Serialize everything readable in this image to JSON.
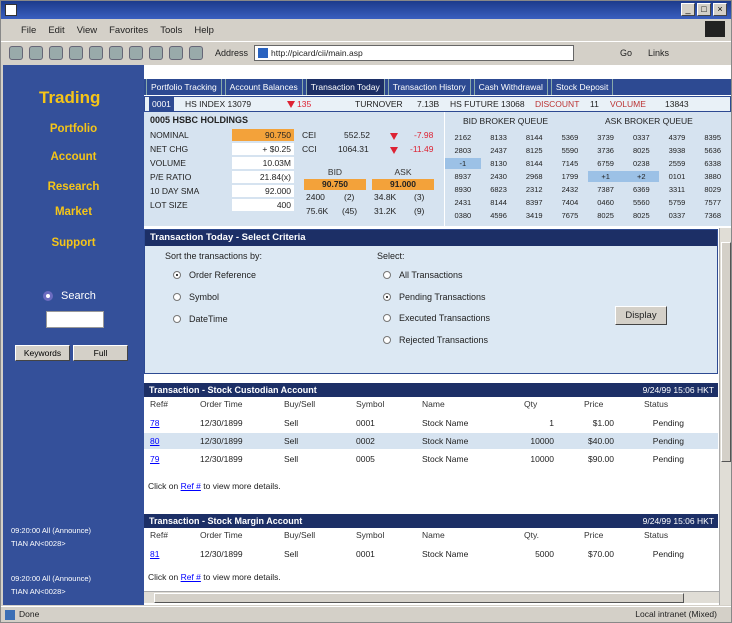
{
  "menu": [
    "File",
    "Edit",
    "View",
    "Favorites",
    "Tools",
    "Help"
  ],
  "toolbar": {
    "address_label": "Address",
    "url": "http://picard/cii/main.asp",
    "go": "Go",
    "links": "Links"
  },
  "sidebar": {
    "brand": "Trading",
    "items": [
      "Portfolio",
      "Account",
      "Research",
      "Market",
      "Support"
    ],
    "search_label": "Search",
    "keywords_btn": "Keywords",
    "full_btn": "Full",
    "announcements": [
      "09:20:00 All (Announce)",
      "TIAN AN<0028>",
      "09:20:00 All (Announce)",
      "TIAN AN<0028>"
    ]
  },
  "tabs": [
    "Portfolio Tracking",
    "Account Balances",
    "Transaction Today",
    "Transaction History",
    "Cash Withdrawal",
    "Stock Deposit"
  ],
  "ticker": {
    "code": "0001",
    "hsi_label": "HS INDEX 13079",
    "hsi_change": "135",
    "turnover_label": "TURNOVER",
    "turnover": "7.13B",
    "future_label": "HS FUTURE 13068",
    "discount_label": "DISCOUNT",
    "discount": "11",
    "volume_label": "VOLUME",
    "volume": "13843"
  },
  "quote": {
    "header": "0005 HSBC HOLDINGS",
    "labels": [
      "NOMINAL",
      "NET CHG",
      "VOLUME",
      "P/E RATIO",
      "10 DAY SMA",
      "LOT SIZE"
    ],
    "values": [
      "90.750",
      "+ $0.25",
      "10.03M",
      "21.84(x)",
      "92.000",
      "400"
    ],
    "cei_label": "CEI",
    "cei_val": "552.52",
    "cei_chg": "-7.98",
    "cci_label": "CCI",
    "cci_val": "1064.31",
    "cci_chg": "-11.49",
    "bid_label": "BID",
    "ask_label": "ASK",
    "bid": "90.750",
    "ask": "91.000",
    "bid_rows": [
      [
        "2400",
        "(2)"
      ],
      [
        "75.6K",
        "(45)"
      ]
    ],
    "ask_rows": [
      [
        "34.8K",
        "(3)"
      ],
      [
        "31.2K",
        "(9)"
      ]
    ]
  },
  "queue": {
    "bid_title": "BID BROKER QUEUE",
    "ask_title": "ASK BROKER QUEUE",
    "rows": [
      [
        "2162",
        "8133",
        "8144",
        "5369",
        "3739",
        "0337",
        "4379",
        "8395"
      ],
      [
        "2803",
        "2437",
        "8125",
        "5590",
        "3736",
        "8025",
        "3938",
        "5636"
      ],
      [
        "-1",
        "8130",
        "8144",
        "7145",
        "6759",
        "0238",
        "2559",
        "6338"
      ],
      [
        "8937",
        "2430",
        "2968",
        "1799",
        "+1",
        "+2",
        "0101",
        "3880"
      ],
      [
        "8930",
        "6823",
        "2312",
        "2432",
        "7387",
        "6369",
        "3311",
        "8029"
      ],
      [
        "2431",
        "8144",
        "8397",
        "7404",
        "0460",
        "5560",
        "5759",
        "7577"
      ],
      [
        "0380",
        "4596",
        "3419",
        "7675",
        "8025",
        "8025",
        "0337",
        "7368"
      ]
    ]
  },
  "criteria": {
    "title": "Transaction Today - Select Criteria",
    "sort_label": "Sort the transactions by:",
    "sort_options": [
      "Order Reference",
      "Symbol",
      "DateTime"
    ],
    "select_label": "Select:",
    "select_options": [
      "All Transactions",
      "Pending Transactions",
      "Executed Transactions",
      "Rejected Transactions"
    ],
    "display_btn": "Display"
  },
  "custodian": {
    "title": "Transaction - Stock Custodian Account",
    "timestamp": "9/24/99 15:06 HKT",
    "columns": [
      "Ref#",
      "Order Time",
      "Buy/Sell",
      "Symbol",
      "Name",
      "Qty",
      "Price",
      "Status"
    ],
    "rows": [
      [
        "78",
        "12/30/1899",
        "Sell",
        "0001",
        "Stock Name",
        "1",
        "$1.00",
        "Pending"
      ],
      [
        "80",
        "12/30/1899",
        "Sell",
        "0002",
        "Stock Name",
        "10000",
        "$40.00",
        "Pending"
      ],
      [
        "79",
        "12/30/1899",
        "Sell",
        "0005",
        "Stock Name",
        "10000",
        "$90.00",
        "Pending"
      ]
    ],
    "note_prefix": "Click on ",
    "note_link": "Ref #",
    "note_suffix": " to view more details."
  },
  "margin": {
    "title": "Transaction - Stock Margin Account",
    "timestamp": "9/24/99 15:06 HKT",
    "columns": [
      "Ref#",
      "Order Time",
      "Buy/Sell",
      "Symbol",
      "Name",
      "Qty.",
      "Price",
      "Status"
    ],
    "rows": [
      [
        "81",
        "12/30/1899",
        "Sell",
        "0001",
        "Stock Name",
        "5000",
        "$70.00",
        "Pending"
      ]
    ],
    "note_prefix": "Click on ",
    "note_link": "Ref #",
    "note_suffix": " to view more details."
  },
  "status": {
    "left": "Done",
    "right": "Local intranet (Mixed)"
  }
}
